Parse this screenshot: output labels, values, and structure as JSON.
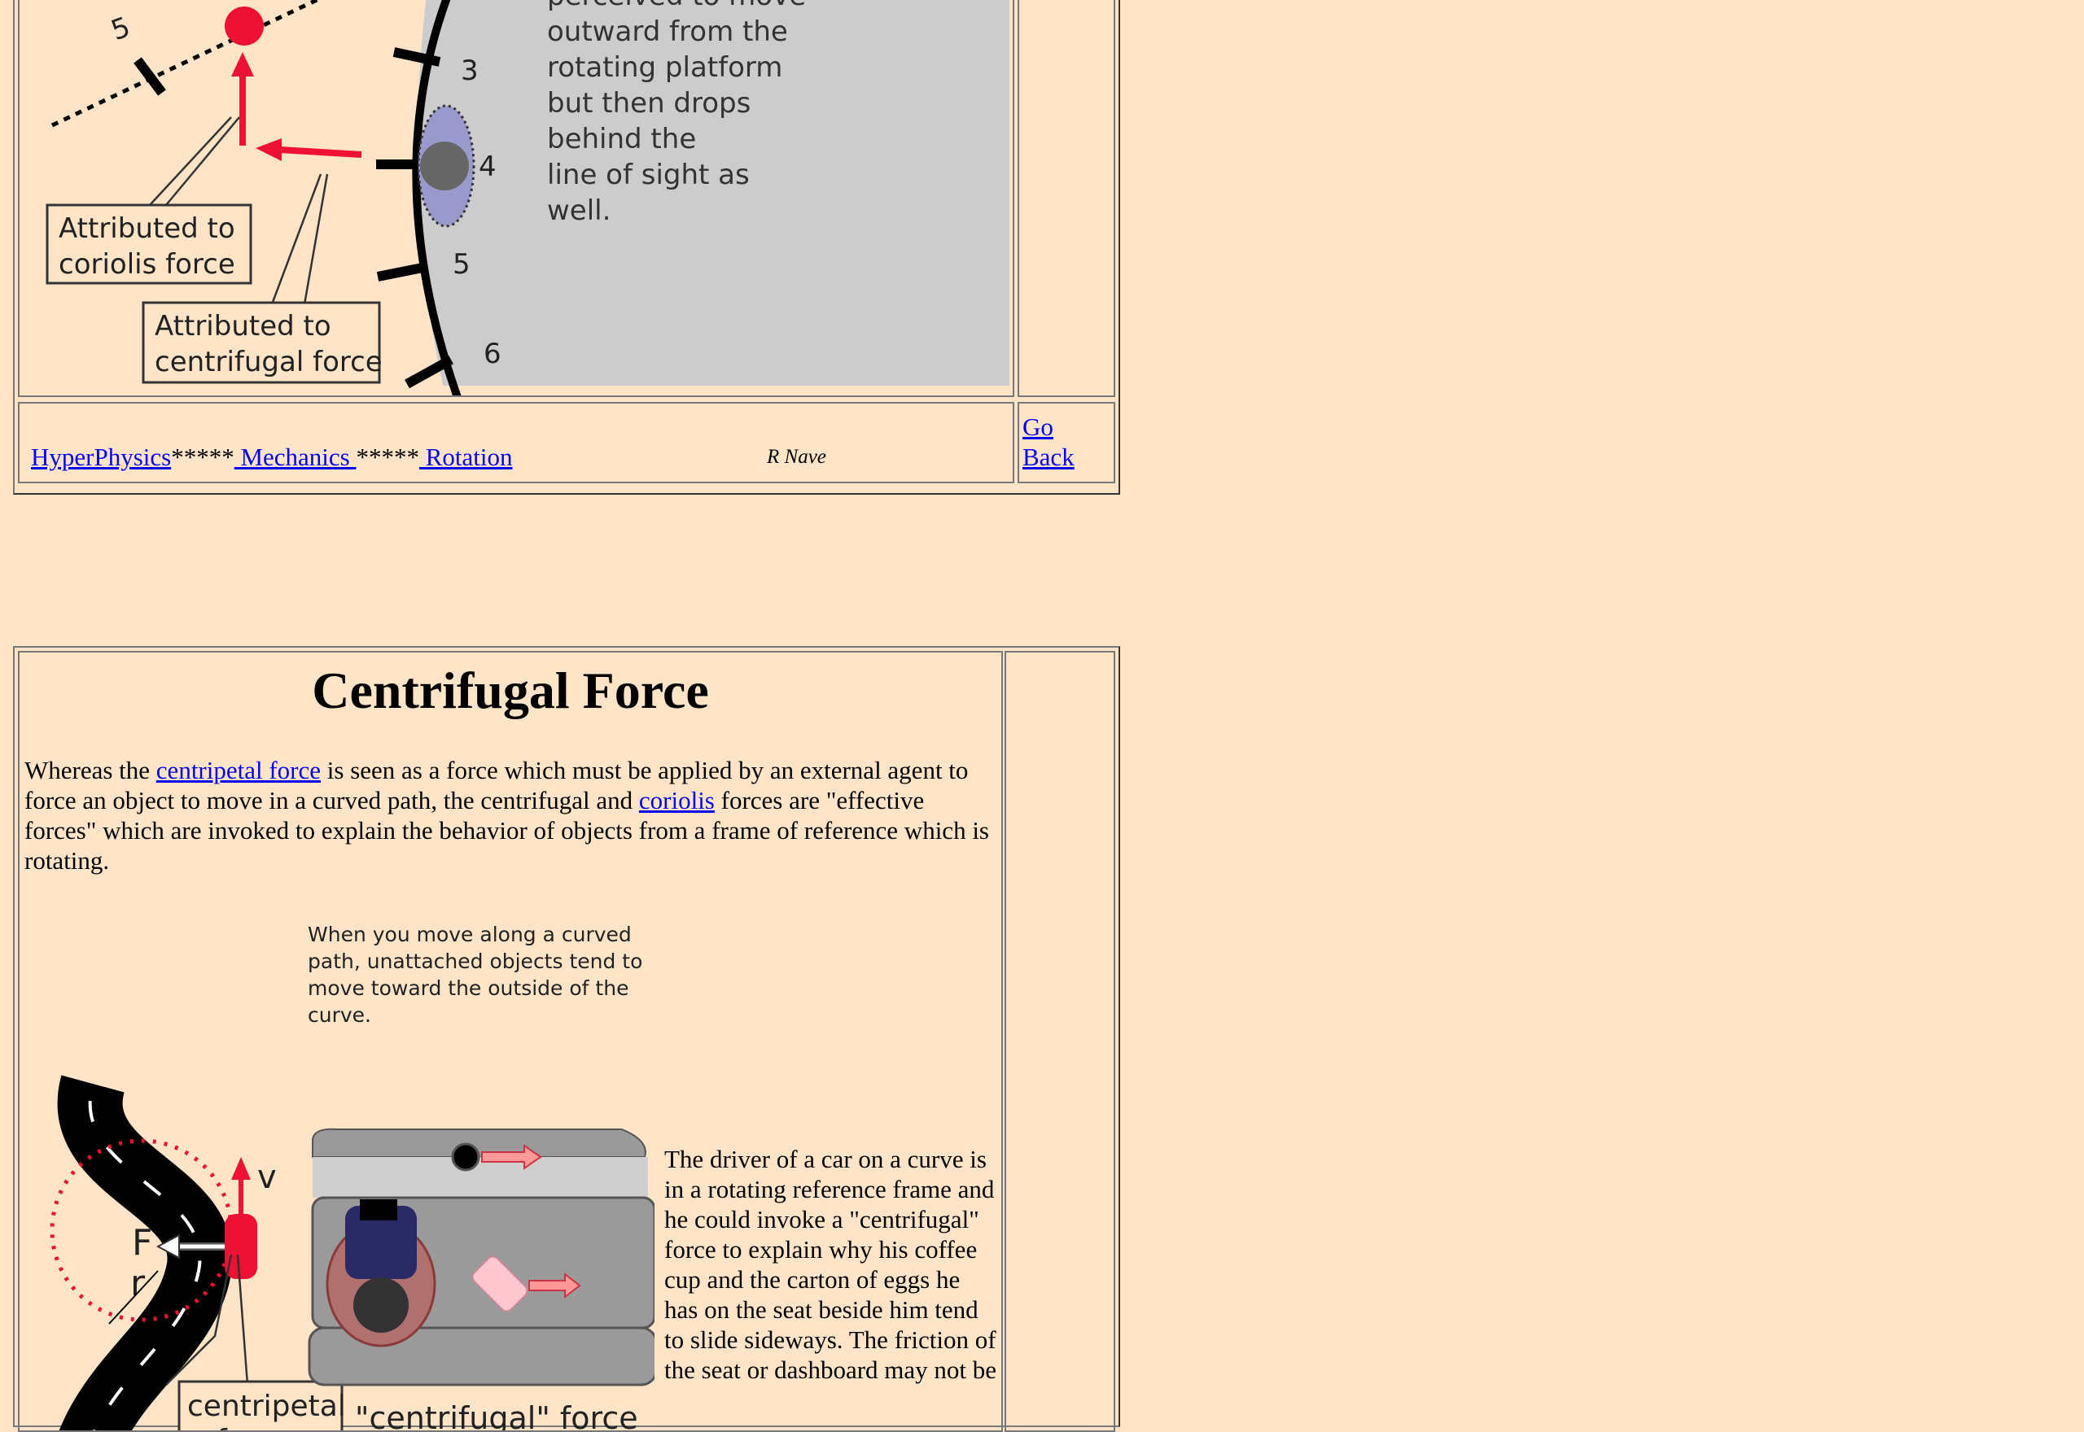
{
  "top_figure": {
    "labels": {
      "tick_5_left": "5",
      "tick_3": "3",
      "tick_4": "4",
      "tick_5": "5",
      "tick_6": "6",
      "coriolis_box": [
        "Attributed to",
        "coriolis force"
      ],
      "centrifugal_box": [
        "Attributed to",
        "centrifugal force"
      ]
    },
    "description_lines": [
      "perceived to move",
      "outward from the",
      "rotating platform",
      "but then drops",
      "behind the",
      "line of sight as",
      "well."
    ]
  },
  "nav": {
    "hyperphysics": "HyperPhysics",
    "sep1": "*****",
    "mechanics": " Mechanics ",
    "sep2": "*****",
    "rotation": " Rotation",
    "author": "R Nave",
    "go_back": "Go Back"
  },
  "section": {
    "title": "Centrifugal Force",
    "intro_parts": {
      "p1": "Whereas the ",
      "link1": "centripetal force",
      "p2": " is seen as a force which must be applied by an external agent to force an object to move in a curved path, the centrifugal and ",
      "link2": "coriolis",
      "p3": " forces are \"effective forces\" which are invoked to explain the behavior of objects from a frame of reference which is rotating."
    },
    "figure_caption": "When you  move along a curved path, unattached objects tend to move toward the outside of the curve.",
    "figure_labels": {
      "v": "v",
      "F": "F",
      "r": "r",
      "centripetal": [
        "centripetal",
        "force"
      ],
      "centrifugal": "\"centrifugal\" force"
    },
    "side_text": "The driver of a car on a curve is in a rotating reference frame and he could invoke a \"centrifugal\" force to explain why his coffee cup and the carton of eggs he has on the seat beside him tend to slide sideways. The friction of the seat or dashboard may not be"
  }
}
